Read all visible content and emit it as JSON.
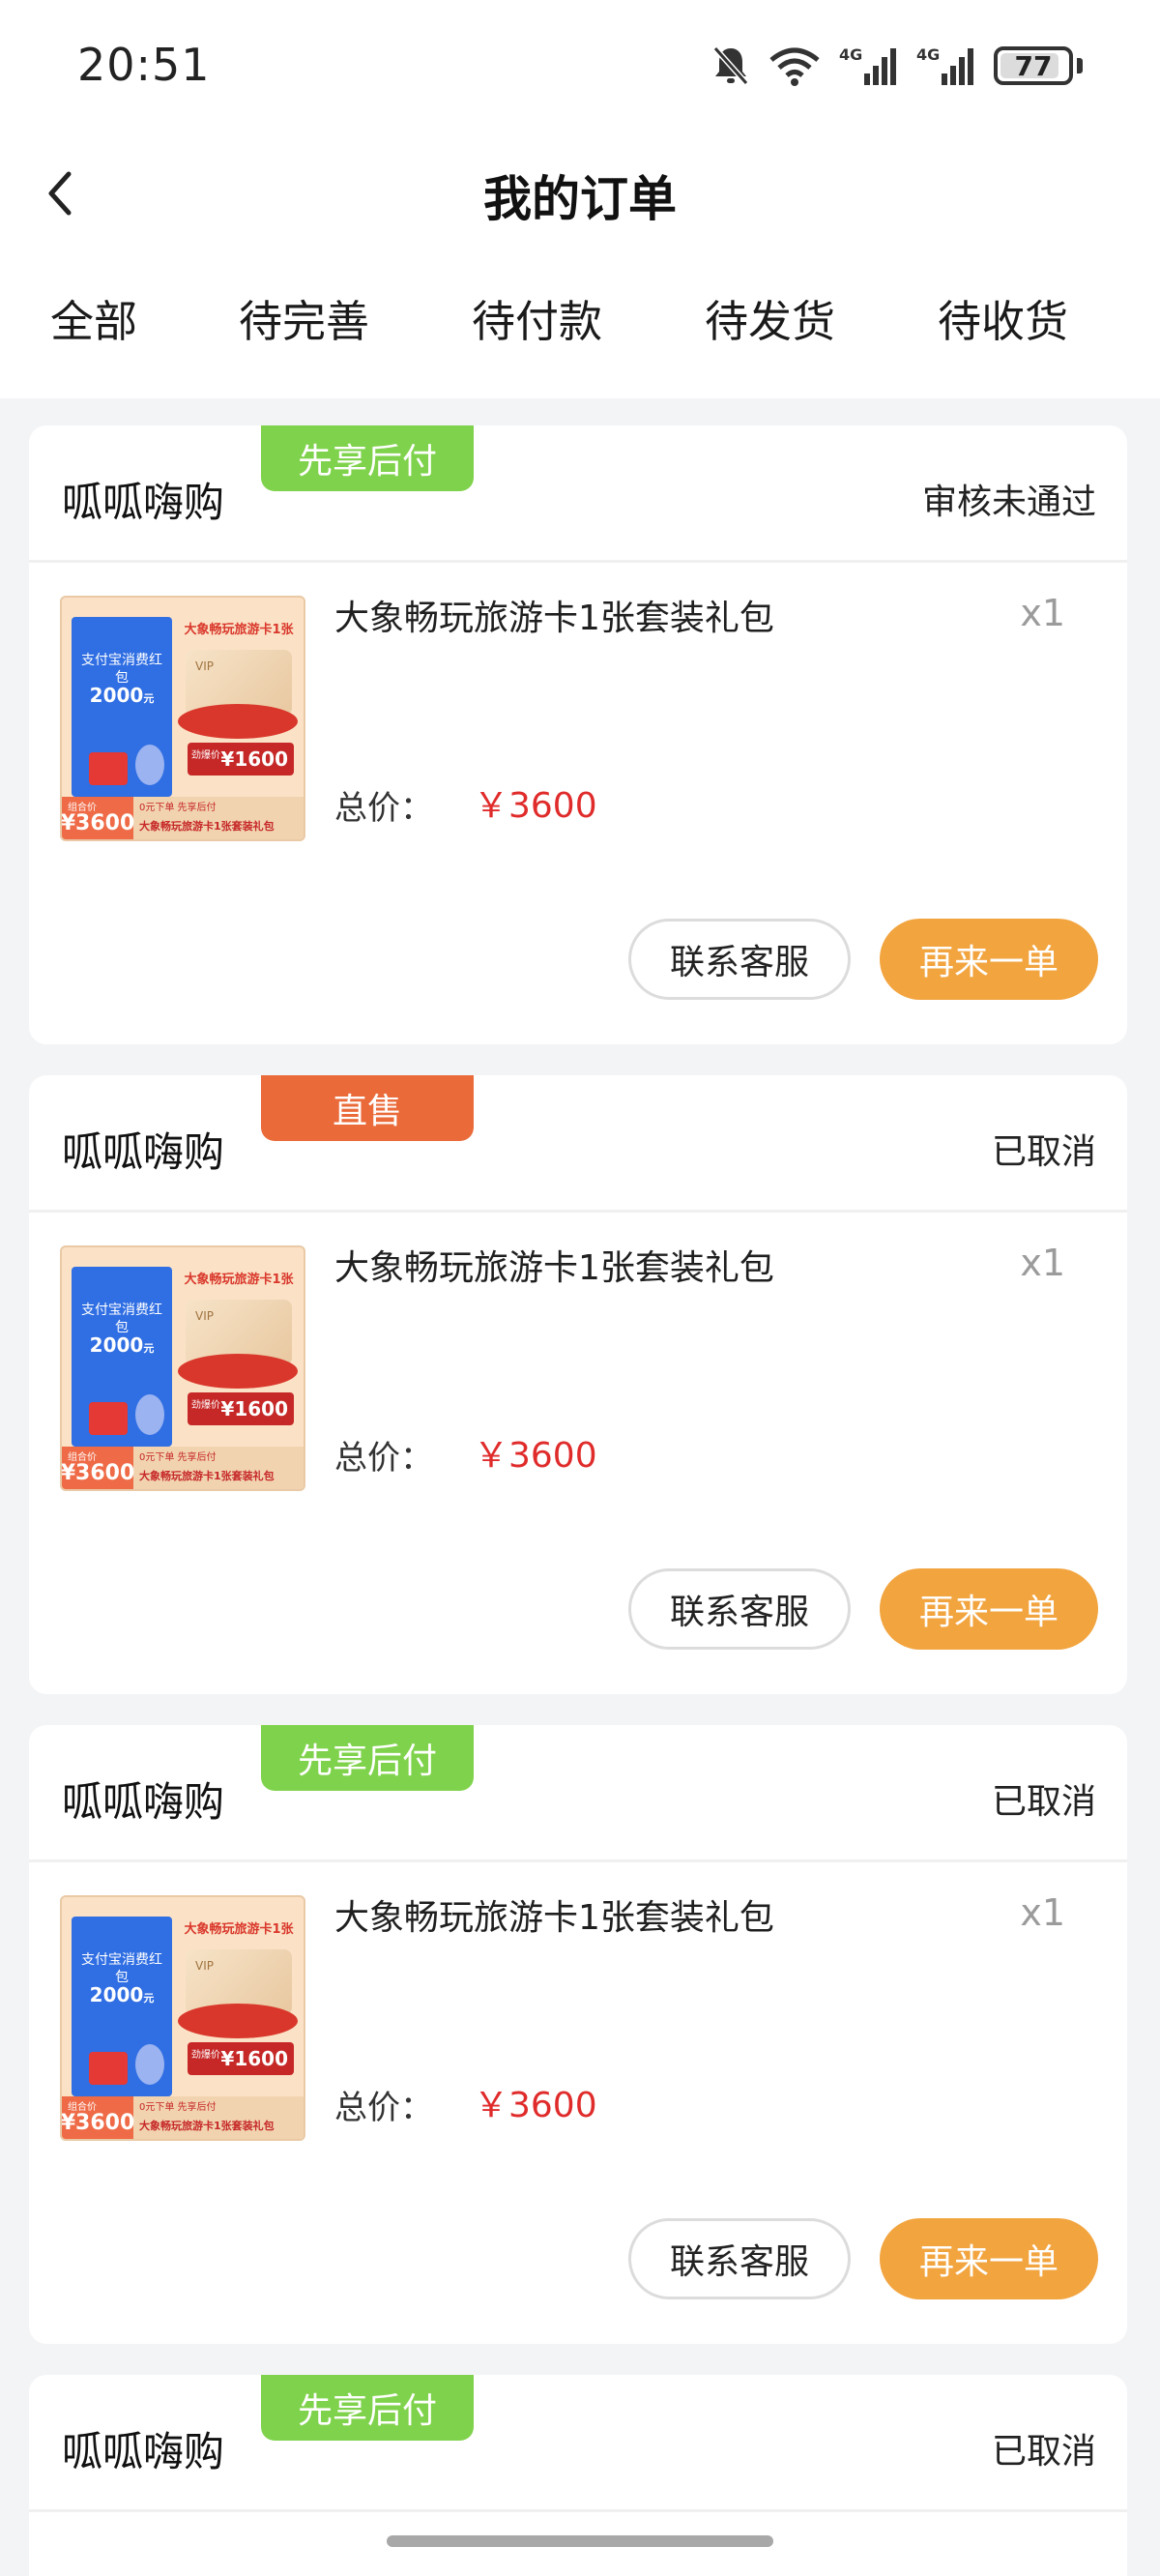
{
  "status_bar": {
    "time": "20:51",
    "battery": "77",
    "battery_level": 0.77,
    "network_1": "4G",
    "network_2": "4G",
    "icons": [
      "bell-muted-icon",
      "wifi-icon",
      "signal-4g-icon",
      "signal-4g-icon",
      "battery-icon"
    ]
  },
  "header": {
    "title": "我的订单",
    "back_icon": "chevron-left-icon"
  },
  "tabs": [
    "全部",
    "待完善",
    "待付款",
    "待发货",
    "待收货"
  ],
  "product_thumbnail": {
    "title": "大象畅玩旅游卡1张",
    "blue_line_1": "支付宝消费红包",
    "blue_amount": "2000",
    "blue_unit": "元",
    "card_text": "VIP",
    "price_label": "劲爆价",
    "price": "¥1600",
    "bottom_label": "组合价",
    "bottom_price": "¥3600",
    "bottom_top": "0元下单 先享后付",
    "bottom_text": "大象畅玩旅游卡1张套装礼包"
  },
  "colors": {
    "tag_green": "#7fd24b",
    "tag_orange": "#ea6a39",
    "price_red": "#e02b2b",
    "button_orange": "#f2a43f"
  },
  "orders": [
    {
      "shop": "呱呱嗨购",
      "tag": "先享后付",
      "status": "审核未通过",
      "product_name": "大象畅玩旅游卡1张套装礼包",
      "qty": "x1",
      "total_label": "总价：",
      "total": "￥3600",
      "contact_label": "联系客服",
      "reorder_label": "再来一单"
    },
    {
      "shop": "呱呱嗨购",
      "tag": "直售",
      "status": "已取消",
      "product_name": "大象畅玩旅游卡1张套装礼包",
      "qty": "x1",
      "total_label": "总价：",
      "total": "￥3600",
      "contact_label": "联系客服",
      "reorder_label": "再来一单"
    },
    {
      "shop": "呱呱嗨购",
      "tag": "先享后付",
      "status": "已取消",
      "product_name": "大象畅玩旅游卡1张套装礼包",
      "qty": "x1",
      "total_label": "总价：",
      "total": "￥3600",
      "contact_label": "联系客服",
      "reorder_label": "再来一单"
    },
    {
      "shop": "呱呱嗨购",
      "tag": "先享后付",
      "status": "已取消"
    }
  ]
}
